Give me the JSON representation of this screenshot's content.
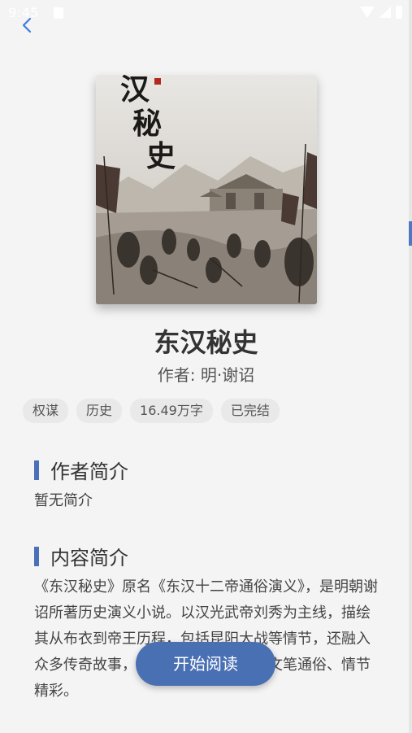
{
  "status_bar": {
    "time": "9:45",
    "icons": [
      "notification-icon",
      "wifi-icon",
      "signal-icon",
      "battery-icon"
    ]
  },
  "nav": {
    "back_icon": "chevron-left-icon"
  },
  "cover": {
    "title_text": "汉秘史"
  },
  "book": {
    "title": "东汉秘史",
    "author": "作者: 明·谢诏"
  },
  "tags": [
    "权谋",
    "历史",
    "16.49万字",
    "已完结"
  ],
  "author_section": {
    "title": "作者简介",
    "body": "暂无简介"
  },
  "content_section": {
    "title": "内容简介",
    "body": "《东汉秘史》原名《东汉十二帝通俗演义》，是明朝谢诏所著历史演义小说。以汉光武帝刘秀为主线，描绘其从布衣到帝王历程，包括昆阳大战等情节，还融入众多传奇故事，展现东汉开国风云，文笔通俗、情节精彩。"
  },
  "actions": {
    "read_label": "开始阅读"
  },
  "colors": {
    "accent": "#4a70b4",
    "background": "#f4f4f4"
  }
}
